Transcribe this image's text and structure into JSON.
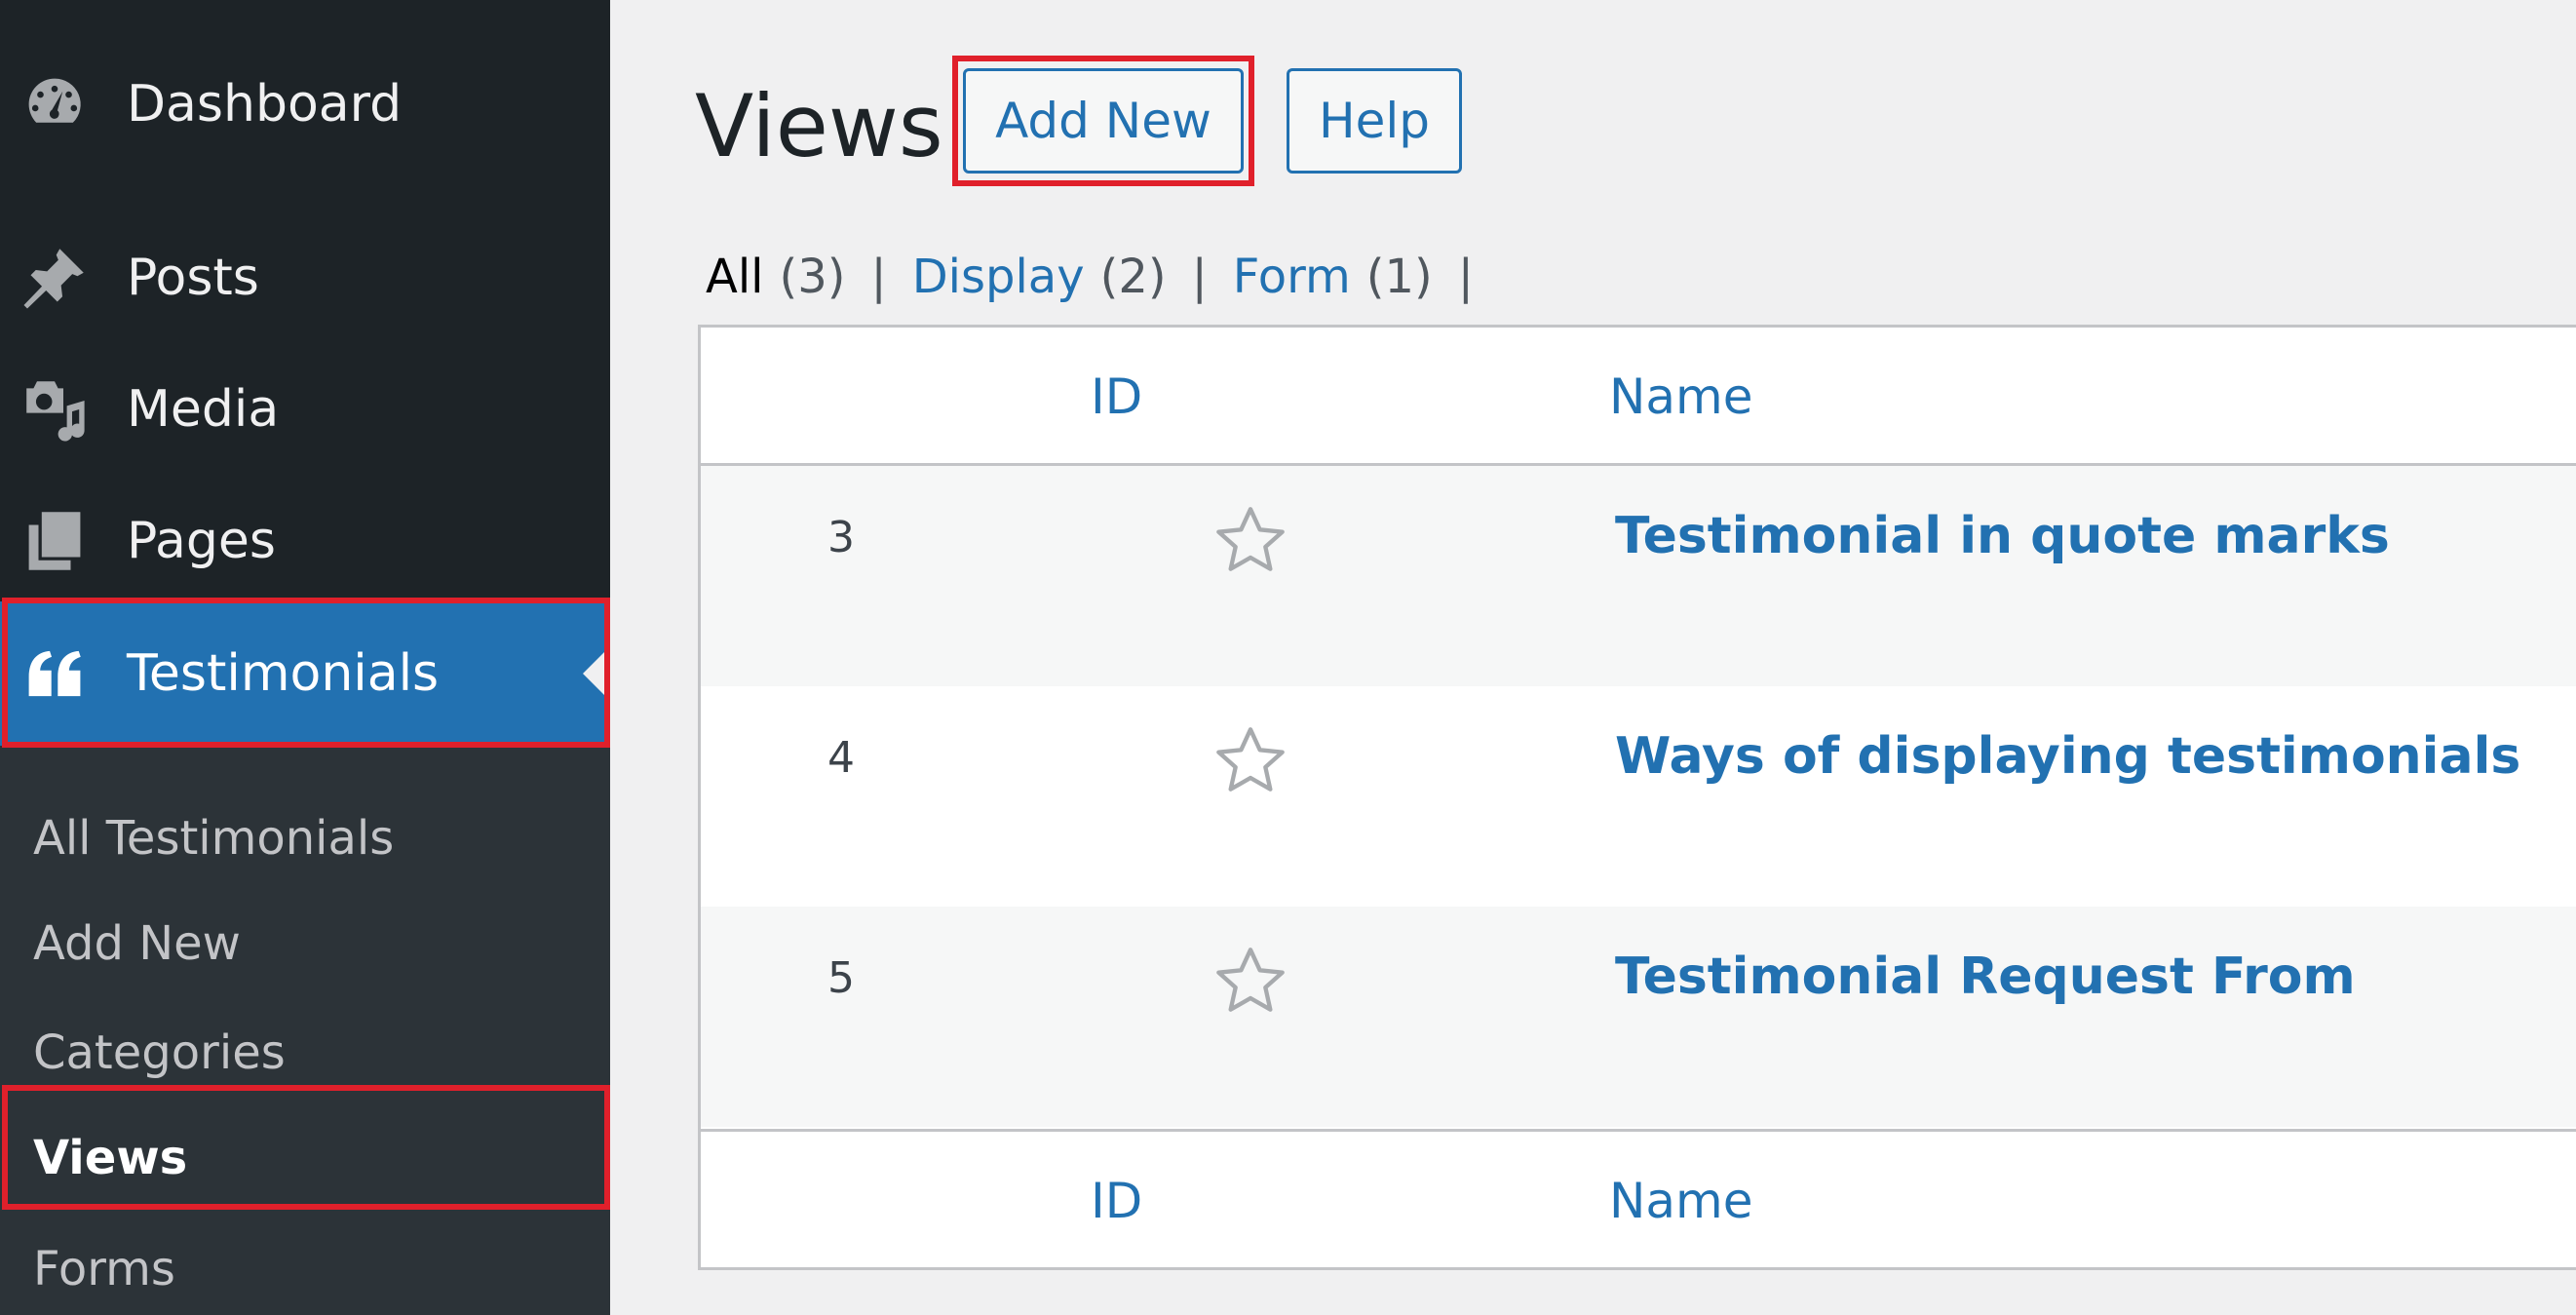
{
  "sidebar": {
    "items": [
      {
        "label": "Dashboard",
        "icon": "dashboard-gauge-icon"
      },
      {
        "label": "Posts",
        "icon": "pushpin-icon"
      },
      {
        "label": "Media",
        "icon": "camera-music-icon"
      },
      {
        "label": "Pages",
        "icon": "pages-icon"
      },
      {
        "label": "Testimonials",
        "icon": "quote-icon"
      }
    ],
    "submenu": [
      {
        "label": "All Testimonials"
      },
      {
        "label": "Add New"
      },
      {
        "label": "Categories"
      },
      {
        "label": "Views"
      },
      {
        "label": "Forms"
      }
    ],
    "active_color": "#2271b1"
  },
  "page": {
    "title": "Views",
    "add_new_label": "Add New",
    "help_label": "Help"
  },
  "filters": [
    {
      "label": "All",
      "count": "(3)"
    },
    {
      "label": "Display",
      "count": "(2)"
    },
    {
      "label": "Form",
      "count": "(1)"
    }
  ],
  "table": {
    "columns": {
      "id": "ID",
      "name": "Name"
    },
    "rows": [
      {
        "id": "3",
        "name": "Testimonial in quote marks"
      },
      {
        "id": "4",
        "name": "Ways of displaying testimonials"
      },
      {
        "id": "5",
        "name": "Testimonial Request From"
      }
    ]
  },
  "highlight_color": "#e0202b"
}
